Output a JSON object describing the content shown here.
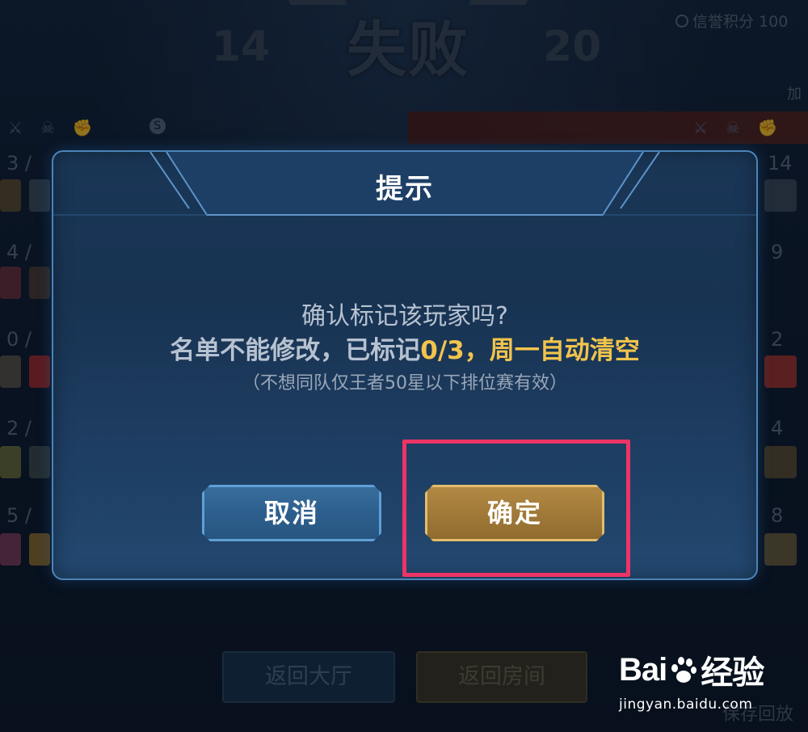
{
  "header": {
    "result_title": "失败",
    "score_left": "14",
    "score_right": "20",
    "credit_label": "信誉积分 100",
    "edge_text": "加"
  },
  "side_numbers_left": [
    "3 /",
    "4 /",
    "0 /",
    "2 /",
    "5 /"
  ],
  "side_numbers_right": [
    "14",
    "9",
    "2",
    "4",
    "8"
  ],
  "dialog": {
    "title": "提示",
    "line1": "确认标记该玩家吗?",
    "line2_prefix": "名单不能修改，已标记",
    "line2_count": "0/3",
    "line2_suffix": "，周一自动清空",
    "line3": "（不想同队仅王者50星以下排位赛有效）",
    "cancel_label": "取消",
    "confirm_label": "确定"
  },
  "bottom": {
    "lobby_label": "返回大厅",
    "room_label": "返回房间",
    "save_replay_label": "保存回放"
  },
  "watermark": {
    "brand_left": "Bai",
    "brand_right": "经验",
    "url": "jingyan.baidu.com"
  },
  "colors": {
    "highlight": "#f2c44c",
    "annotation_box": "#ec3466",
    "dialog_border": "#4c83b8"
  }
}
